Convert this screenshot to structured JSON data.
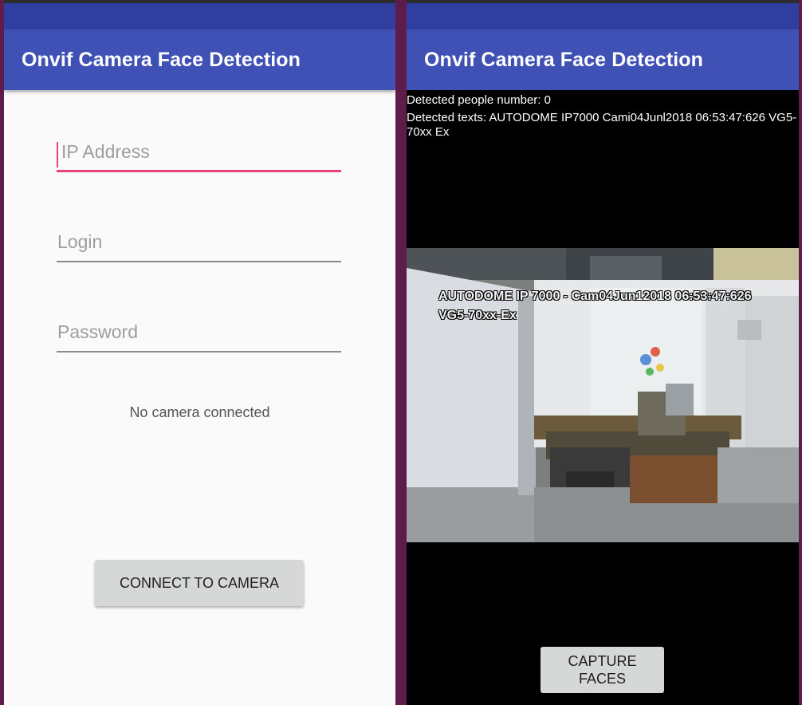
{
  "left_screen": {
    "app_title": "Onvif Camera Face Detection",
    "ip_placeholder": "IP Address",
    "login_placeholder": "Login",
    "password_placeholder": "Password",
    "status_text": "No camera connected",
    "connect_button_label": "CONNECT TO CAMERA"
  },
  "right_screen": {
    "app_title": "Onvif Camera Face Detection",
    "people_count_text": "Detected people number: 0",
    "detected_texts": "Detected texts: AUTODOME IP7000 Cami04Junl2018 06:53:47:626 VG5-70xx Ex",
    "video_osd_line1": "AUTODOME IP 7000 - Cam04Jun12018   06:53:47:626",
    "video_osd_line2": "VG5-70xx-Ex",
    "capture_button_label": "CAPTURE FACES"
  },
  "colors": {
    "primary": "#3f51b5",
    "primary_dark": "#303f9f",
    "accent": "#ec407a",
    "frame": "#5e1c4a"
  }
}
